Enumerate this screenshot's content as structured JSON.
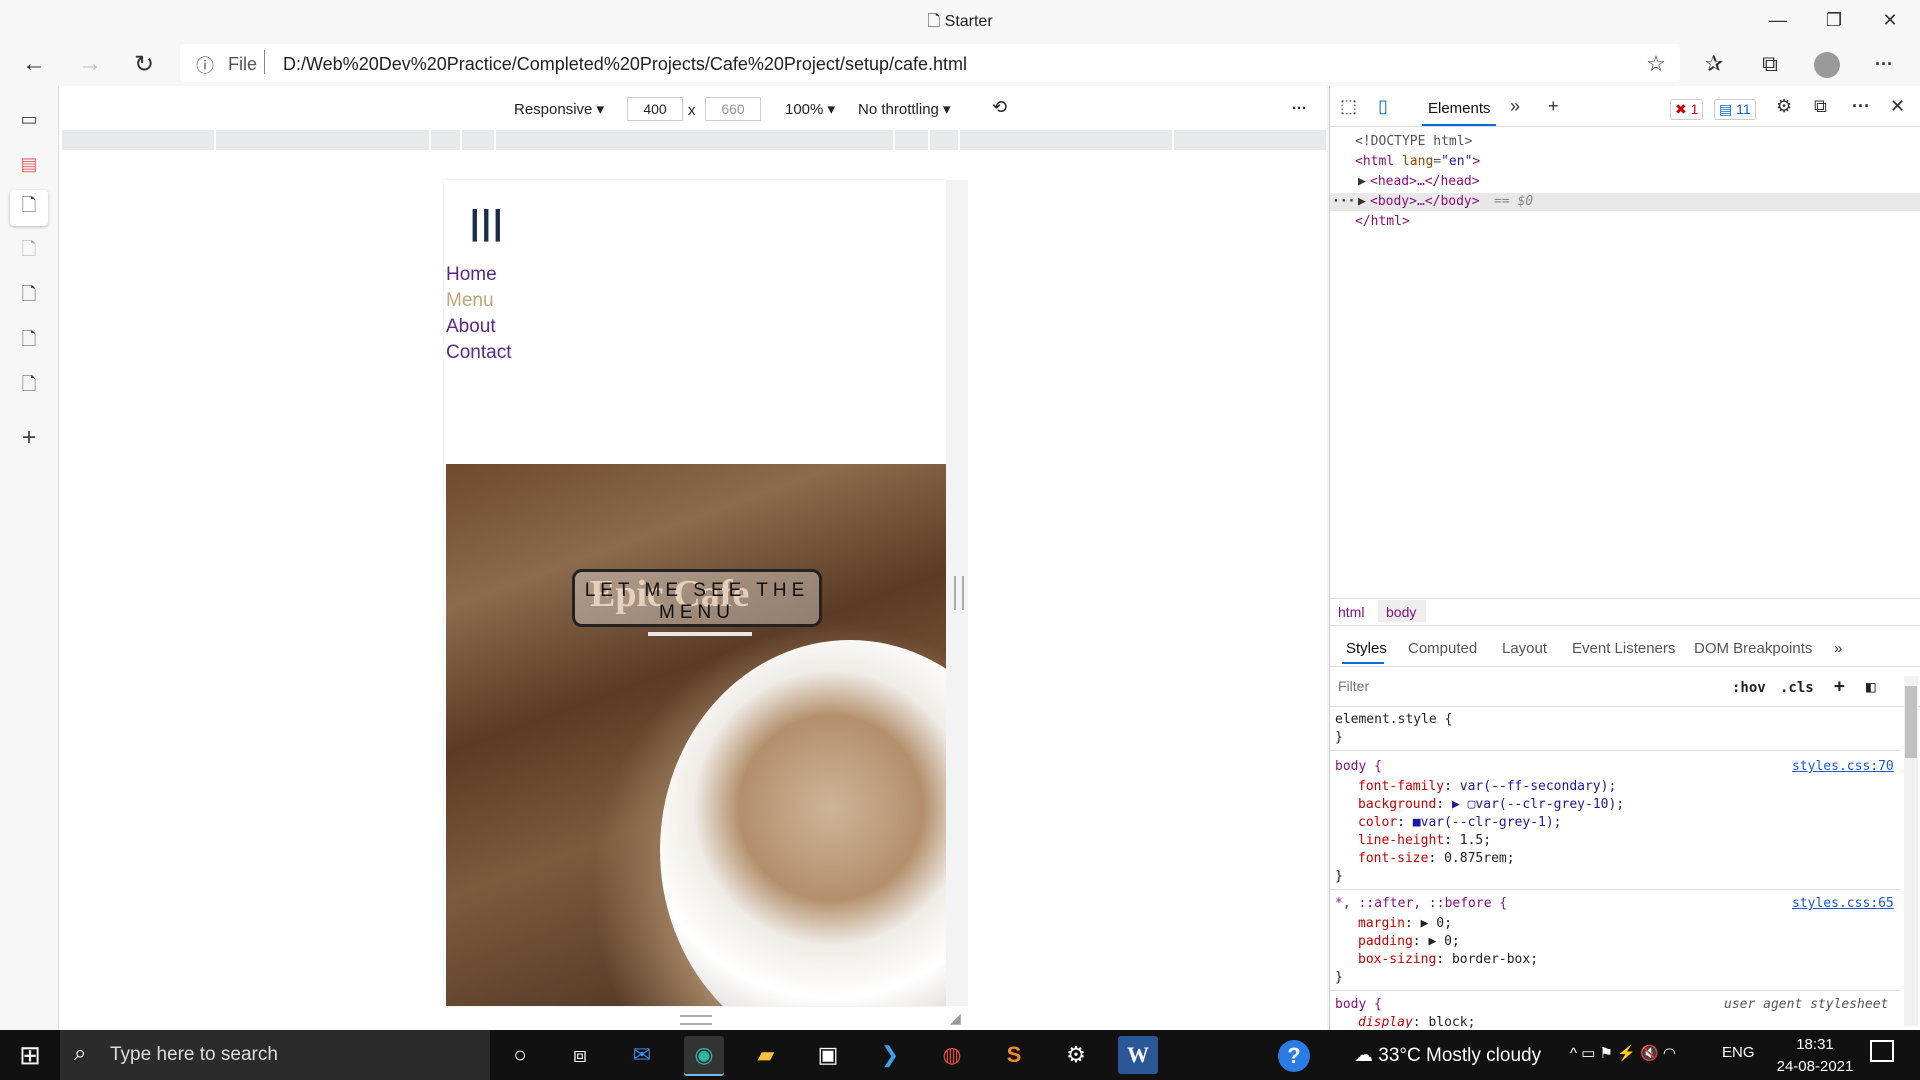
{
  "window": {
    "title": "Starter",
    "minimize": "—",
    "restore": "❐",
    "close": "✕"
  },
  "navbar": {
    "back_icon": "←",
    "forward_icon": "→",
    "refresh_icon": "↻",
    "info_icon": "ⓘ",
    "file_label": "File",
    "url": "D:/Web%20Dev%20Practice/Completed%20Projects/Cafe%20Project/setup/cafe.html",
    "star_icon": "☆",
    "favorites_icon": "✰",
    "collections_icon": "⧉",
    "more_icon": "···"
  },
  "sidebar": {
    "tabs": [
      "▭",
      "▤",
      "🗋",
      "🗋",
      "🗋",
      "🗋",
      "🗋"
    ],
    "add": "+"
  },
  "device_toolbar": {
    "mode": "Responsive ▾",
    "width": "400",
    "times": "x",
    "height": "660",
    "zoom": "100% ▾",
    "throttling": "No throttling ▾",
    "rotate_icon": "⟲",
    "more": "···"
  },
  "emulated_page": {
    "burger": "|||",
    "nav": [
      "Home",
      "Menu",
      "About",
      "Contact"
    ],
    "nav_colors": [
      "#5b2a86",
      "#c9a27e",
      "#5b2a86",
      "#5b2a86"
    ],
    "hero_title": "Epic Cafe",
    "hero_button": "LET ME SEE THE MENU"
  },
  "devtools": {
    "inspect_icon": "⬚",
    "device_icon": "▯",
    "elements_tab": "Elements",
    "more_tabs": "»",
    "add_tab": "+",
    "errors": "✖ 1",
    "messages": "▤ 11",
    "settings_icon": "⚙",
    "dock_icon": "⧉",
    "menu_icon": "···",
    "close_icon": "✕",
    "dom": {
      "doctype": "<!DOCTYPE html>",
      "html_open": "<html ",
      "html_attr_name": "lang",
      "html_attr_value": "\"en\"",
      "html_close_bracket": ">",
      "head": "<head>…</head>",
      "body": "<body>…</body>",
      "body_marker": "== $0",
      "html_end": "</html>"
    },
    "breadcrumbs": [
      "html",
      "body"
    ],
    "subtabs": [
      "Styles",
      "Computed",
      "Layout",
      "Event Listeners",
      "DOM Breakpoints",
      "»"
    ],
    "filter_placeholder": "Filter",
    "hov": ":hov",
    "cls": ".cls",
    "plus": "+",
    "toggle_icon": "◧",
    "rules": {
      "element_style": "element.style {",
      "close": "}",
      "body_selector": "body {",
      "body_source": "styles.css:70",
      "body_props": [
        {
          "name": "font-family",
          "value": "var(--ff-secondary);"
        },
        {
          "name": "background",
          "value": "▶ ▢var(--clr-grey-10);"
        },
        {
          "name": "color",
          "value": "■var(--clr-grey-1);"
        },
        {
          "name": "line-height",
          "value": "1.5;"
        },
        {
          "name": "font-size",
          "value": "0.875rem;"
        }
      ],
      "universal_selector": "*, ::after, ::before {",
      "universal_source": "styles.css:65",
      "universal_props": [
        {
          "name": "margin",
          "value": "▶ 0;"
        },
        {
          "name": "padding",
          "value": "▶ 0;"
        },
        {
          "name": "box-sizing",
          "value": "border-box;"
        }
      ],
      "ua_selector": "body {",
      "ua_source": "user agent stylesheet",
      "ua_prop": {
        "name": "display",
        "value": "block;"
      }
    }
  },
  "taskbar": {
    "start_icon": "⊞",
    "search_icon": "⌕",
    "search_placeholder": "Type here to search",
    "apps": [
      "○",
      "⧈",
      "✉",
      "◉",
      "▰",
      "▣",
      "❯",
      "◍",
      "S",
      "⚙",
      "W"
    ],
    "help_icon": "?",
    "weather": "33°C  Mostly cloudy",
    "tray": "^  ▭  ⚑  ⚡  🔇  ◠",
    "language": "ENG",
    "time": "18:31",
    "date": "24-08-2021"
  }
}
